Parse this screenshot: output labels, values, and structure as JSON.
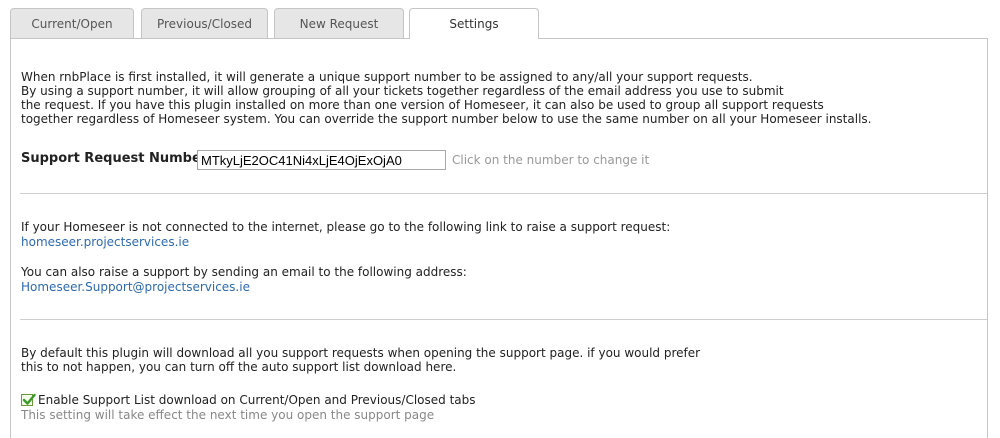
{
  "tabs": [
    {
      "label": "Current/Open",
      "active": false
    },
    {
      "label": "Previous/Closed",
      "active": false
    },
    {
      "label": "New Request",
      "active": false
    },
    {
      "label": "Settings",
      "active": true
    }
  ],
  "intro": {
    "line1": "When rnbPlace is first installed, it will generate a unique support number to be assigned to any/all your support requests.",
    "line2": "By using a support number, it will allow grouping of all your tickets together regardless of the email address you use to submit",
    "line3": "the request. If you have this plugin installed on more than one version of Homeseer, it can also be used to group all support requests",
    "line4": "together regardless of Homeseer system. You can override the support number below to use the same number on all your Homeseer installs."
  },
  "support_request": {
    "label": "Support Request Number:",
    "value": "MTkyLjE2OC41Ni4xLjE4OjExOjA0",
    "hint": "Click on the number to change it"
  },
  "offline": {
    "text": "If your Homeseer is not connected to the internet, please go to the following link to raise a support request:",
    "link": "homeseer.projectservices.ie"
  },
  "email": {
    "text": "You can also raise a support by sending an email to the following address:",
    "link": "Homeseer.Support@projectservices.ie"
  },
  "download": {
    "line1": "By default this plugin will download all you support requests when opening the support page. if you would prefer",
    "line2": "this to not happen, you can turn off the auto support list download here.",
    "checkbox_label": "Enable Support List download on Current/Open and Previous/Closed tabs",
    "checked": true,
    "note": "This setting will take effect the next time you open the support page"
  },
  "colors": {
    "link": "#2e6ab0",
    "check": "#3c9a2a",
    "hint": "#999999"
  }
}
